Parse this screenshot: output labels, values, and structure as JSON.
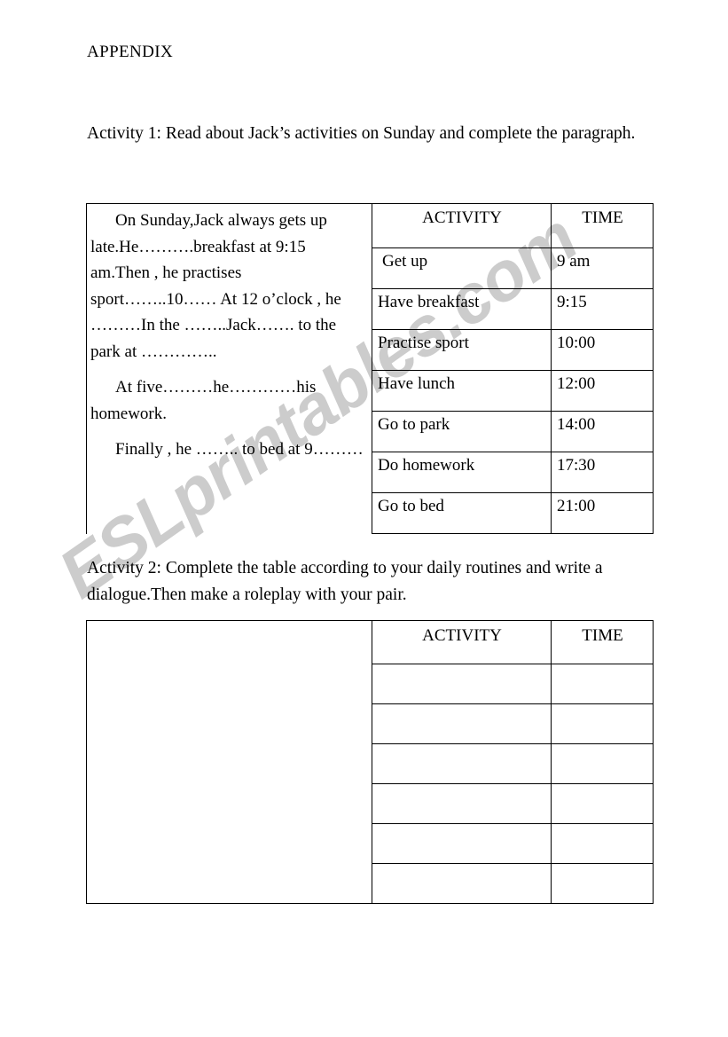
{
  "document": {
    "heading": "APPENDIX",
    "watermark": "ESLprintables.com"
  },
  "activity_one": {
    "instruction": "Activity 1: Read about Jack’s activities on Sunday and complete the paragraph.",
    "paragraph": [
      "On Sunday,Jack always gets up late.He……….breakfast at 9:15 am.Then , he practises sport……..10…… At 12 o’clock , he ………In the ……..Jack……. to the park at …………..",
      "At five………he…………his homework.",
      "Finally , he …….. to bed at 9………"
    ],
    "table": {
      "headers": [
        "ACTIVITY",
        "TIME"
      ],
      "rows": [
        {
          "activity": "Get up",
          "time": "9 am"
        },
        {
          "activity": "Have breakfast",
          "time": "9:15"
        },
        {
          "activity": "Practise sport",
          "time": "10:00"
        },
        {
          "activity": "Have lunch",
          "time": "12:00"
        },
        {
          "activity": "Go to park",
          "time": "14:00"
        },
        {
          "activity": "Do homework",
          "time": "17:30"
        },
        {
          "activity": "Go to bed",
          "time": "21:00"
        }
      ]
    }
  },
  "activity_two": {
    "instruction": "Activity 2: Complete the table according to your daily routines and write a dialogue.Then make a roleplay with your pair.",
    "table": {
      "headers": [
        "ACTIVITY",
        "TIME"
      ],
      "rows": [
        {
          "activity": "",
          "time": ""
        },
        {
          "activity": "",
          "time": ""
        },
        {
          "activity": "",
          "time": ""
        },
        {
          "activity": "",
          "time": ""
        },
        {
          "activity": "",
          "time": ""
        },
        {
          "activity": "",
          "time": ""
        }
      ]
    }
  }
}
